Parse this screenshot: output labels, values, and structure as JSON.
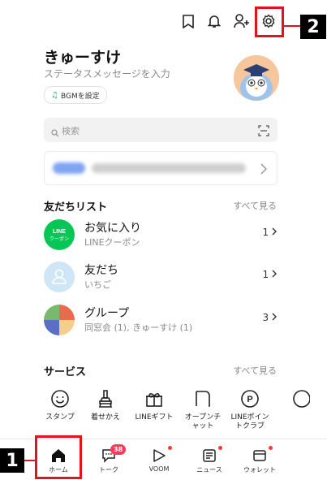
{
  "header": {
    "icons": [
      "bookmark-icon",
      "bell-icon",
      "add-friend-icon",
      "settings-icon"
    ]
  },
  "profile": {
    "name": "きゅーすけ",
    "status": "ステータスメッセージを入力",
    "bgm_label": "BGMを設定"
  },
  "search": {
    "placeholder": "検索"
  },
  "friends": {
    "title": "友だちリスト",
    "see_all": "すべて見る",
    "items": [
      {
        "name": "お気に入り",
        "sub": "LINEクーポン",
        "count": "1",
        "icon_text": "LINE\nクーポン"
      },
      {
        "name": "友だち",
        "sub": "いちご",
        "count": "1"
      },
      {
        "name": "グループ",
        "sub": "同窓会 (1), きゅーすけ (1)",
        "count": "3"
      }
    ]
  },
  "services": {
    "title": "サービス",
    "see_all": "すべて見る",
    "items": [
      {
        "label": "スタンプ"
      },
      {
        "label": "着せかえ"
      },
      {
        "label": "LINEギフト"
      },
      {
        "label": "オープンチ\nャット"
      },
      {
        "label": "LINEポイン\nトクラブ"
      }
    ]
  },
  "tabs": [
    {
      "label": "ホーム"
    },
    {
      "label": "トーク",
      "badge": "38"
    },
    {
      "label": "VOOM"
    },
    {
      "label": "ニュース"
    },
    {
      "label": "ウォレット"
    }
  ],
  "callouts": {
    "home": "1",
    "settings": "2"
  },
  "colors": {
    "accent": "#06c755",
    "callout": "#e1131c",
    "badge": "#ff3b5c"
  }
}
